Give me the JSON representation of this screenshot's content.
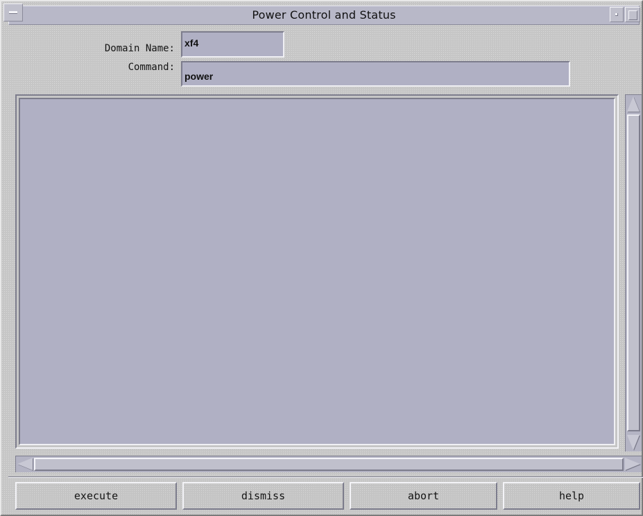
{
  "window": {
    "title": "Power Control and Status"
  },
  "form": {
    "domain_label": "Domain Name:",
    "domain_value": "xf4",
    "command_label": "Command:",
    "command_value": "power"
  },
  "output": {
    "text": ""
  },
  "buttons": {
    "execute": "execute",
    "dismiss": "dismiss",
    "abort": "abort",
    "help": "help"
  },
  "colors": {
    "window_bg": "#c6c6c6",
    "field_bg": "#b0b0c4",
    "titlebar_bg": "#b8b8c8"
  }
}
